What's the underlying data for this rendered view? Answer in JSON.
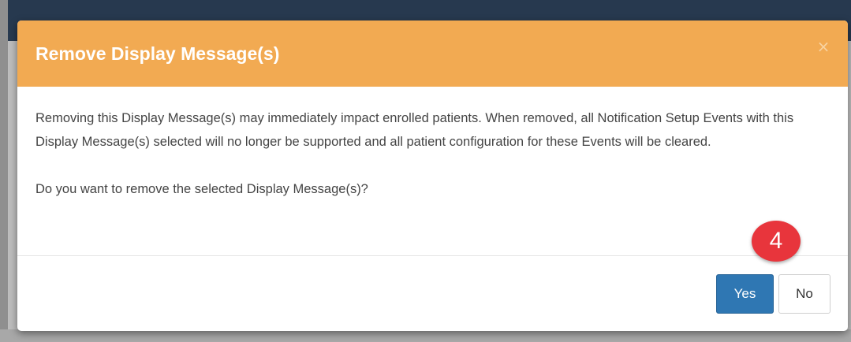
{
  "dialog": {
    "title": "Remove Display Message(s)",
    "close_symbol": "×",
    "body_text": "Removing this Display Message(s) may immediately impact enrolled patients. When removed, all Notification Setup Events with this Display Message(s) selected will no longer be supported and all patient configuration for these Events will be cleared.",
    "question": "Do you want to remove the selected Display Message(s)?",
    "buttons": {
      "yes_label": "Yes",
      "no_label": "No"
    }
  },
  "step_marker": "4",
  "colors": {
    "header": "#f2aa52",
    "primary_button": "#2f77b3",
    "step_marker": "#e8353c"
  }
}
